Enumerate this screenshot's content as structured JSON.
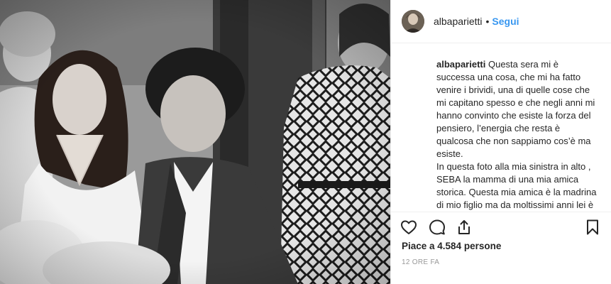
{
  "post": {
    "photo_alt": "",
    "header": {
      "username": "albaparietti",
      "separator": "•",
      "follow_label": "Segui"
    },
    "caption": {
      "username": "albaparietti",
      "text": " Questa sera mi è successa una cosa, che mi ha fatto venire i brividi, una di quelle cose che mi capitano spesso e che negli anni mi hanno convinto che esiste la forza del pensiero, l’energia che resta è qualcosa che non sappiamo cos’è ma esiste.\nIn questa foto alla mia sinistra in alto , SEBA la mamma di una mia amica storica. Questa mia amica è la madrina di mio figlio ma da moltissimi anni lei è lontana dalla mia vita, come a volte succede"
    },
    "actions": {
      "like_icon": "heart-outline-icon",
      "comment_icon": "comment-icon",
      "share_icon": "share-icon",
      "save_icon": "bookmark-icon"
    },
    "likes_text": "Piace a 4.584 persone",
    "timestamp": "12 ORE FA",
    "colors": {
      "follow": "#3897f0",
      "text": "#262626",
      "muted": "#999999",
      "border": "#efefef"
    }
  }
}
